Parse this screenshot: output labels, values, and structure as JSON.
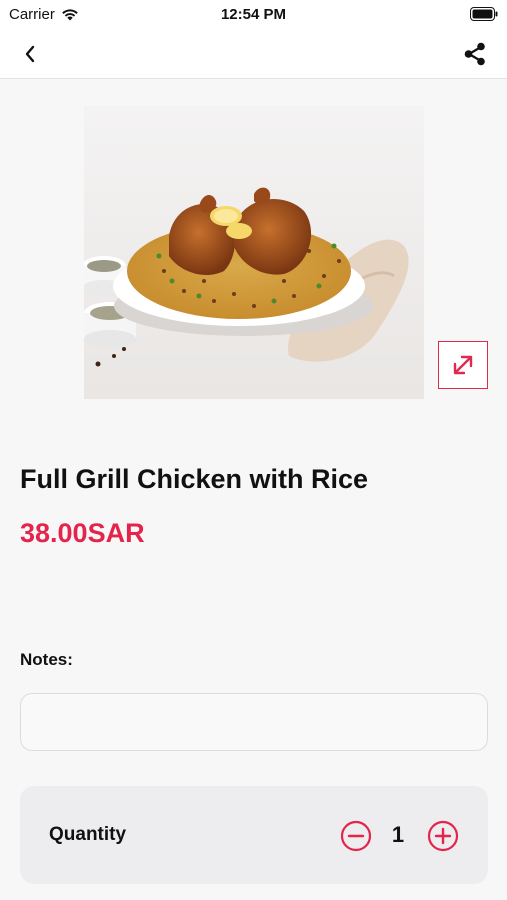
{
  "status_bar": {
    "carrier": "Carrier",
    "time": "12:54 PM"
  },
  "nav": {
    "back_icon": "chevron-left-icon",
    "share_icon": "share-icon"
  },
  "product": {
    "image_description_icon": "food-photo",
    "name": "Full Grill Chicken with Rice",
    "price": "38.00SAR"
  },
  "notes": {
    "label": "Notes:",
    "value": "",
    "placeholder": ""
  },
  "quantity": {
    "label": "Quantity",
    "value": "1"
  },
  "colors": {
    "accent": "#e5244c",
    "background": "#f7f7f8",
    "card": "#ededef"
  }
}
